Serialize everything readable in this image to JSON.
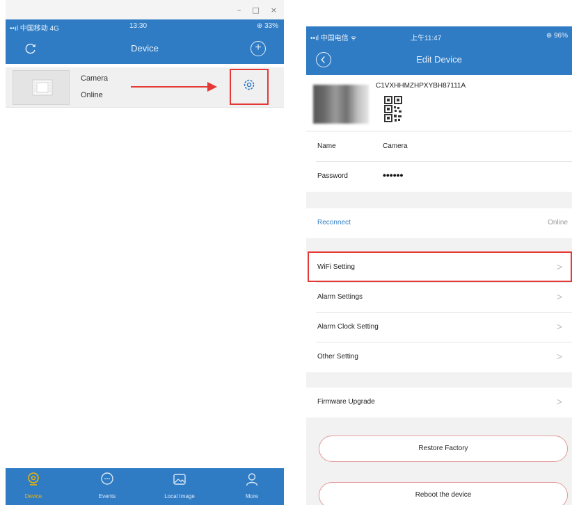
{
  "left": {
    "window_controls": [
      "–",
      "□",
      "×"
    ],
    "status": {
      "signal": "••ıl 中国移动 4G",
      "time": "13:30",
      "battery": "⊕ 33%"
    },
    "nav": {
      "title": "Device",
      "refresh_icon": "refresh-icon",
      "add_icon": "plus-icon",
      "add_glyph": "+"
    },
    "device": {
      "name": "Camera",
      "status": "Online",
      "settings_icon": "gear-icon"
    },
    "tabs": [
      {
        "label": "Device",
        "icon": "camera-icon",
        "active": true
      },
      {
        "label": "Events",
        "icon": "chat-icon",
        "active": false
      },
      {
        "label": "Local Image",
        "icon": "image-icon",
        "active": false
      },
      {
        "label": "More",
        "icon": "person-icon",
        "active": false
      }
    ],
    "colors": {
      "header": "#2f7cc4",
      "highlight": "#e53935",
      "active_tab": "#f3b400"
    }
  },
  "right": {
    "status": {
      "signal": "••ıl 中国电信 ᯤ",
      "time": "上午11:47",
      "battery": "⊕ 96%"
    },
    "nav": {
      "title": "Edit Device",
      "back_icon": "back-icon"
    },
    "device": {
      "uid": "C1VXHHMZHPXYBH87111A"
    },
    "fields": [
      {
        "label": "Name",
        "value": "Camera"
      },
      {
        "label": "Password",
        "value": "••••••"
      }
    ],
    "reconnect": {
      "label": "Reconnect",
      "status": "Online"
    },
    "settings": [
      {
        "label": "WiFi Setting",
        "chevron": ">"
      },
      {
        "label": "Alarm Settings",
        "chevron": ">"
      },
      {
        "label": "Alarm Clock Setting",
        "chevron": ">"
      },
      {
        "label": "Other Setting",
        "chevron": ">"
      }
    ],
    "firmware": {
      "label": "Firmware Upgrade",
      "chevron": ">"
    },
    "buttons": {
      "restore": "Restore Factory",
      "reboot": "Reboot the device"
    }
  }
}
